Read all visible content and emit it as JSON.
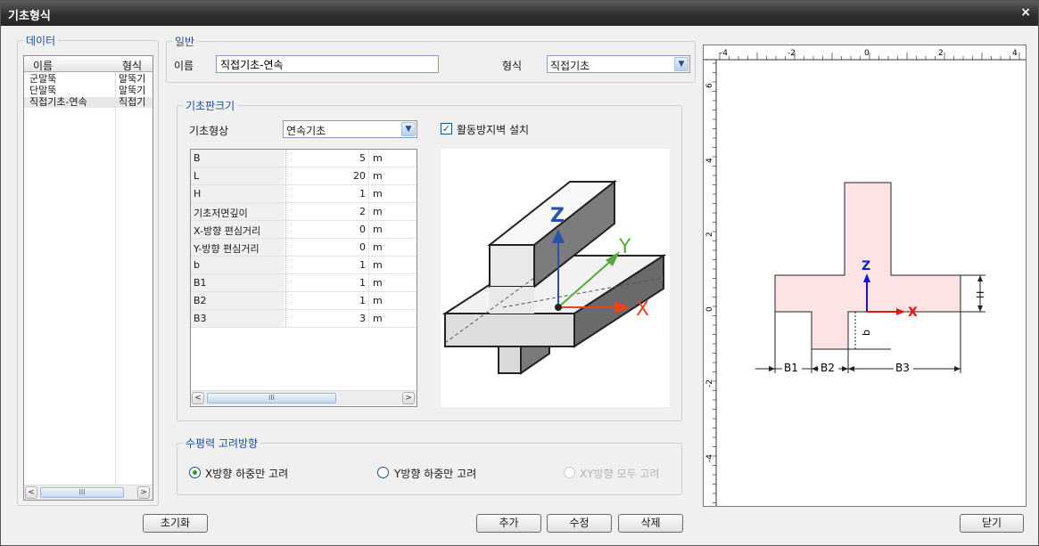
{
  "window": {
    "title": "기초형식",
    "close": "×"
  },
  "data_group": {
    "legend": "데이터",
    "columns": [
      "이름",
      "형식"
    ],
    "rows": [
      {
        "name": "군말뚝",
        "type": "말뚝기"
      },
      {
        "name": "단말뚝",
        "type": "말뚝기"
      },
      {
        "name": "직접기초-연속",
        "type": "직접기"
      }
    ],
    "scroll_left": "<",
    "scroll_right": ">",
    "thumb_grip": "III"
  },
  "general": {
    "legend": "일반",
    "name_label": "이름",
    "name_value": "직접기초-연속",
    "type_label": "형식",
    "type_value": "직접기초"
  },
  "plate": {
    "legend": "기초판크기",
    "shape_label": "기초형상",
    "shape_value": "연속기초",
    "shear_key_label": "활동방지벽 설치",
    "shear_key_checked": true,
    "check_mark": "✓",
    "combo_arrow": "▼",
    "properties": [
      {
        "name": "B",
        "value": "5",
        "unit": "m"
      },
      {
        "name": "L",
        "value": "20",
        "unit": "m"
      },
      {
        "name": "H",
        "value": "1",
        "unit": "m"
      },
      {
        "name": "기초저면깊이",
        "value": "2",
        "unit": "m"
      },
      {
        "name": "X-방향 편심거리",
        "value": "0",
        "unit": "m"
      },
      {
        "name": "Y-방향 편심거리",
        "value": "0",
        "unit": "m"
      },
      {
        "name": "b",
        "value": "1",
        "unit": "m"
      },
      {
        "name": "B1",
        "value": "1",
        "unit": "m"
      },
      {
        "name": "B2",
        "value": "1",
        "unit": "m"
      },
      {
        "name": "B3",
        "value": "3",
        "unit": "m"
      }
    ],
    "axes": {
      "x": "X",
      "y": "Y",
      "z": "Z"
    }
  },
  "horizontal": {
    "legend": "수평력 고려방향",
    "options": [
      {
        "label": "X방향 하중만 고려",
        "selected": true,
        "enabled": true
      },
      {
        "label": "Y방향 하중만 고려",
        "selected": false,
        "enabled": true
      },
      {
        "label": "XY방향 모두 고려",
        "selected": false,
        "enabled": false
      }
    ]
  },
  "buttons": {
    "reset": "초기화",
    "add": "추가",
    "modify": "수정",
    "delete": "삭제",
    "close": "닫기"
  },
  "preview": {
    "top_ticks": [
      "-4",
      "-2",
      "0",
      "2",
      "4"
    ],
    "left_ticks": [
      "6",
      "4",
      "2",
      "0",
      "-2",
      "-4"
    ],
    "axis_z": "Z",
    "axis_x": "X",
    "dim_h": "H",
    "dim_b": "b",
    "dim_b1": "B1",
    "dim_b2": "B2",
    "dim_b3": "B3",
    "fill_color": "#fde3e3",
    "axis_color": "#1414e6",
    "x_axis_color": "#e61414"
  },
  "colors": {
    "legend": "#1f4fa0",
    "z_axis_3d": "#2455a8",
    "y_axis_3d": "#5aaa3a",
    "x_axis_3d": "#e8451a"
  }
}
